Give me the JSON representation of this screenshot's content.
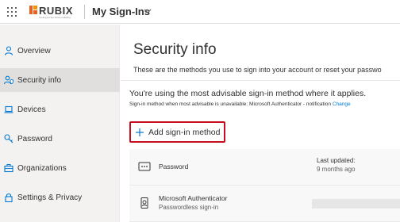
{
  "header": {
    "brand_name": "RUBIX",
    "brand_tagline": "Tooling for the future-enabling",
    "app_title": "My Sign-Ins",
    "brand_color": "#e8601c"
  },
  "sidebar": {
    "items": [
      {
        "label": "Overview",
        "icon": "person-icon"
      },
      {
        "label": "Security info",
        "icon": "security-info-icon",
        "active": true
      },
      {
        "label": "Devices",
        "icon": "laptop-icon"
      },
      {
        "label": "Password",
        "icon": "key-icon"
      },
      {
        "label": "Organizations",
        "icon": "briefcase-icon"
      },
      {
        "label": "Settings & Privacy",
        "icon": "lock-icon"
      }
    ]
  },
  "main": {
    "title": "Security info",
    "description": "These are the methods you use to sign into your account or reset your passwo",
    "advisable": "You're using the most advisable sign-in method where it applies.",
    "unavailable_text": "Sign-in method when most advisable is unavailable: Microsoft Authenticator - notification",
    "change_link": "Change",
    "add_method_label": "Add sign-in method",
    "methods": [
      {
        "name": "Password",
        "sub": "",
        "updated_label": "Last updated:",
        "updated_value": "9 months ago",
        "icon": "password-dots-icon"
      },
      {
        "name": "Microsoft Authenticator",
        "sub": "Passwordless sign-in",
        "icon": "authenticator-phone-icon"
      }
    ]
  },
  "colors": {
    "accent": "#0078d4",
    "highlight_border": "#c50f1f"
  }
}
